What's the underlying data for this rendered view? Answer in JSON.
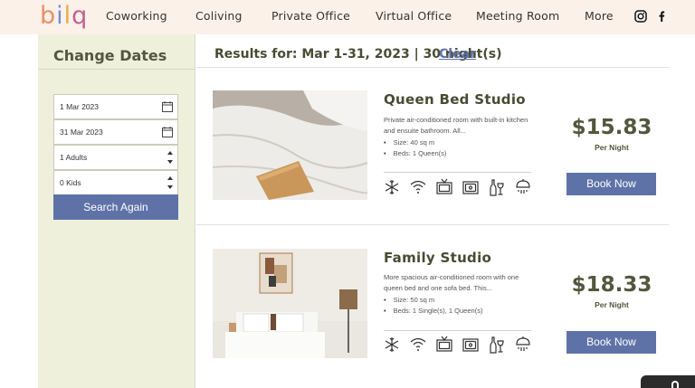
{
  "header": {
    "logo_letters": [
      "b",
      "i",
      "l",
      "q"
    ],
    "nav": [
      {
        "label": "Coworking"
      },
      {
        "label": "Coliving"
      },
      {
        "label": "Private Office"
      },
      {
        "label": "Virtual Office"
      },
      {
        "label": "Meeting Room"
      },
      {
        "label": "More"
      }
    ],
    "social": [
      "instagram-icon",
      "facebook-icon"
    ]
  },
  "sidebar": {
    "title": "Change Dates",
    "check_in": "1 Mar 2023",
    "check_out": "31 Mar 2023",
    "adults": "1 Adults",
    "kids": "0 Kids",
    "search_label": "Search Again"
  },
  "results": {
    "summary": "Results for: Mar 1-31, 2023 | 30 night(s)",
    "clear_label": "Clear"
  },
  "rooms": [
    {
      "title": "Queen Bed Studio",
      "desc_line1": "Private air-conditioned room with built-in kitchen",
      "desc_line2": "and ensuite bathroom. All...",
      "size": "Size: 40 sq m",
      "beds": "Beds: 1 Queen(s)",
      "price": "$15.83",
      "per_night": "Per Night",
      "book_label": "Book Now"
    },
    {
      "title": "Family Studio",
      "desc_line1": "More spacious air-conditioned room with one",
      "desc_line2": "queen bed and one sofa bed. This...",
      "size": "Size: 50 sq m",
      "beds": "Beds: 1 Single(s), 1 Queen(s)",
      "price": "$18.33",
      "per_night": "Per Night",
      "book_label": "Book Now"
    }
  ],
  "amenities": [
    "air-conditioning-icon",
    "wifi-icon",
    "tv-icon",
    "microwave-icon",
    "bar-icon",
    "shower-icon"
  ],
  "colors": {
    "header_bg": "#fbf1e9",
    "sidebar_bg": "#eef0dc",
    "accent_blue": "#5f72a8",
    "olive_text": "#52573d"
  }
}
